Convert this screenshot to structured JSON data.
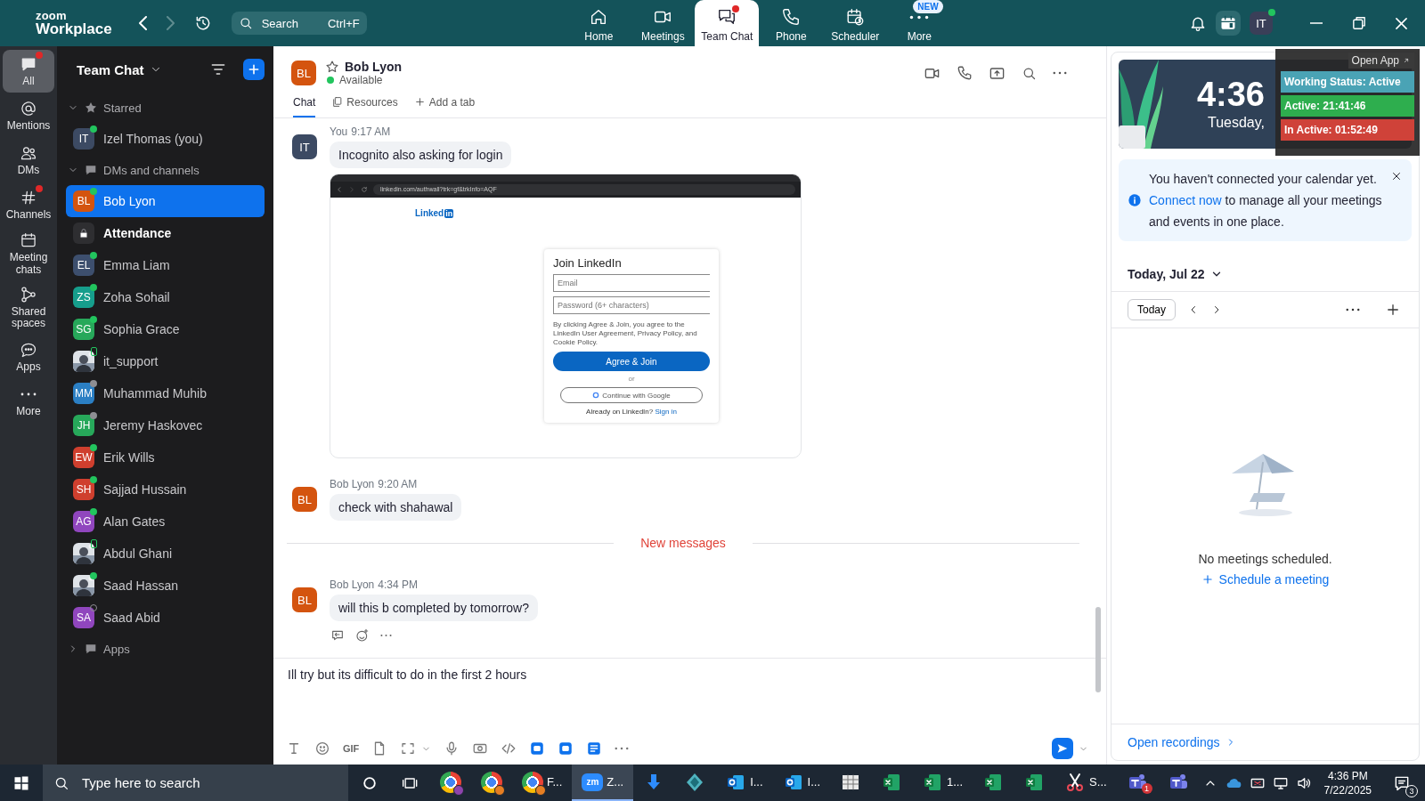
{
  "top_bar": {
    "logo_small": "zoom",
    "logo_large": "Workplace",
    "search": {
      "placeholder": "Search",
      "shortcut": "Ctrl+F"
    },
    "nav": [
      {
        "kind": "home",
        "label": "Home",
        "selected": false,
        "dot": false
      },
      {
        "kind": "video",
        "label": "Meetings",
        "selected": false,
        "dot": false
      },
      {
        "kind": "chat",
        "label": "Team Chat",
        "selected": true,
        "dot": true
      },
      {
        "kind": "phone",
        "label": "Phone",
        "selected": false,
        "dot": false
      },
      {
        "kind": "scheduler",
        "label": "Scheduler",
        "selected": false,
        "dot": false
      },
      {
        "kind": "more",
        "label": "More",
        "selected": false,
        "dot": false,
        "badge": "NEW"
      }
    ],
    "avatar": "IT"
  },
  "rail": [
    {
      "kind": "chat",
      "label": "All",
      "selected": true,
      "dot": true
    },
    {
      "kind": "at",
      "label": "Mentions",
      "selected": false,
      "dot": false
    },
    {
      "kind": "people",
      "label": "DMs",
      "selected": false,
      "dot": false
    },
    {
      "kind": "hash",
      "label": "Channels",
      "selected": false,
      "dot": true
    },
    {
      "kind": "calendar",
      "label": "Meeting chats",
      "selected": false,
      "dot": false
    },
    {
      "kind": "nodes",
      "label": "Shared spaces",
      "selected": false,
      "dot": false
    },
    {
      "kind": "bubble",
      "label": "Apps",
      "selected": false,
      "dot": false
    },
    {
      "kind": "more",
      "label": "More",
      "selected": false,
      "dot": false
    }
  ],
  "sidebar": {
    "title": "Team Chat",
    "sections": [
      {
        "kind": "star",
        "label": "Starred",
        "expanded": true,
        "items": [
          {
            "kind": "initials",
            "initials": "IT",
            "name": "Izel Thomas (you)",
            "color": "#3c4a63",
            "presence": {
              "kind": "online"
            },
            "selected": false,
            "bold": false
          }
        ]
      },
      {
        "kind": "chat",
        "label": "DMs and channels",
        "expanded": true,
        "items": [
          {
            "kind": "initials",
            "initials": "BL",
            "name": "Bob Lyon",
            "color": "#d4540f",
            "presence": {
              "kind": "online"
            },
            "selected": true,
            "bold": false
          },
          {
            "kind": "lock",
            "name": "Attendance",
            "selected": false,
            "bold": true
          },
          {
            "kind": "initials",
            "initials": "EL",
            "name": "Emma Liam",
            "color": "#3d4f6e",
            "presence": {
              "kind": "online"
            },
            "selected": false,
            "bold": false
          },
          {
            "kind": "initials",
            "initials": "ZS",
            "name": "Zoha Sohail",
            "color": "#169e8c",
            "presence": {
              "kind": "online"
            },
            "selected": false,
            "bold": false
          },
          {
            "kind": "initials",
            "initials": "SG",
            "name": "Sophia Grace",
            "color": "#27a85a",
            "presence": {
              "kind": "online"
            },
            "selected": false,
            "bold": false
          },
          {
            "kind": "picture",
            "name": "it_support",
            "presence": {
              "kind": "mobile"
            },
            "selected": false,
            "bold": false
          },
          {
            "kind": "initials",
            "initials": "MM",
            "name": "Muhammad Muhib",
            "color": "#2b7fc4",
            "presence": {
              "kind": "away"
            },
            "selected": false,
            "bold": false
          },
          {
            "kind": "initials",
            "initials": "JH",
            "name": "Jeremy Haskovec",
            "color": "#27a85a",
            "presence": {
              "kind": "away"
            },
            "selected": false,
            "bold": false
          },
          {
            "kind": "initials",
            "initials": "EW",
            "name": "Erik Wills",
            "color": "#cf3f2e",
            "presence": {
              "kind": "online"
            },
            "selected": false,
            "bold": false
          },
          {
            "kind": "initials",
            "initials": "SH",
            "name": "Sajjad Hussain",
            "color": "#cf3f2e",
            "presence": {
              "kind": "online"
            },
            "selected": false,
            "bold": false
          },
          {
            "kind": "initials",
            "initials": "AG",
            "name": "Alan Gates",
            "color": "#9046be",
            "presence": {
              "kind": "online"
            },
            "selected": false,
            "bold": false
          },
          {
            "kind": "picture",
            "name": "Abdul Ghani",
            "presence": {
              "kind": "mobile"
            },
            "selected": false,
            "bold": false
          },
          {
            "kind": "picture",
            "name": "Saad Hassan",
            "presence": {
              "kind": "online"
            },
            "selected": false,
            "bold": false
          },
          {
            "kind": "initials",
            "initials": "SA",
            "name": "Saad Abid",
            "color": "#9046be",
            "presence": {
              "kind": "offline"
            },
            "selected": false,
            "bold": false
          }
        ]
      },
      {
        "kind": "chat",
        "label": "Apps",
        "expanded": false
      }
    ]
  },
  "chat": {
    "header": {
      "initials": "BL",
      "color": "#d4540f",
      "name": "Bob Lyon",
      "status": "Available",
      "starred": false
    },
    "tabs": [
      {
        "kind": "chat",
        "label": "Chat",
        "selected": true
      },
      {
        "kind": "files",
        "label": "Resources",
        "selected": false
      },
      {
        "kind": "add",
        "label": "Add a tab",
        "selected": false
      }
    ],
    "timeline": [
      {
        "kind": "message",
        "sender": "You",
        "time": "9:17 AM",
        "initials": "IT",
        "color": "#3c4a63",
        "text": "Incognito also asking for login",
        "hovered": false,
        "attachment": {
          "url": "linkedin.com/authwall?trk=gf&trkInfo=AQF",
          "logo": "Linked",
          "logo_badge": "in",
          "card_title": "Join LinkedIn",
          "email_placeholder": "Email",
          "password_placeholder": "Password (6+ characters)",
          "terms": "By clicking Agree & Join, you agree to the LinkedIn User Agreement, Privacy Policy, and Cookie Policy.",
          "button": "Agree & Join",
          "separator": "or",
          "google_button": "Continue with Google",
          "signin_prompt": "Already on LinkedIn?",
          "signin_link": "Sign in"
        }
      },
      {
        "kind": "message",
        "sender": "Bob Lyon",
        "time": "9:20 AM",
        "initials": "BL",
        "color": "#d4540f",
        "text": "check with shahawal",
        "hovered": false
      },
      {
        "kind": "divider",
        "label": "New messages"
      },
      {
        "kind": "message",
        "sender": "Bob Lyon",
        "time": "4:34 PM",
        "initials": "BL",
        "color": "#d4540f",
        "text": "will this b completed by tomorrow?",
        "hovered": true
      }
    ],
    "composer": {
      "value": "Ill try but its difficult to do in the first 2 hours",
      "tools": [
        {
          "kind": "format"
        },
        {
          "kind": "emoji"
        },
        {
          "kind": "gif",
          "label": "GIF"
        },
        {
          "kind": "file"
        },
        {
          "kind": "screenshot"
        },
        {
          "kind": "caret"
        },
        {
          "kind": "mic"
        },
        {
          "kind": "video"
        },
        {
          "kind": "code"
        },
        {
          "kind": "app"
        },
        {
          "kind": "app"
        },
        {
          "kind": "doc"
        },
        {
          "kind": "more"
        }
      ]
    }
  },
  "calendar": {
    "widget": {
      "time": "4:36",
      "date": "Tuesday,",
      "open_app": "Open App",
      "statuses": [
        {
          "label": "Working Status: Active",
          "color": "#4aa3b5"
        },
        {
          "label": "Active: 21:41:46",
          "color": "#2eae4e"
        },
        {
          "label": "In Active: 01:52:49",
          "color": "#cf4239"
        }
      ]
    },
    "notice": {
      "text_before": "You haven't connected your calendar yet.",
      "link": "Connect now",
      "text_after": "to manage all your meetings and events in one place."
    },
    "date_label": "Today, Jul 22",
    "today_button": "Today",
    "empty_text": "No meetings scheduled.",
    "schedule_link": "Schedule a meeting",
    "recordings_link": "Open recordings"
  },
  "taskbar": {
    "search_placeholder": "Type here to search",
    "apps": [
      {
        "kind": "chrome",
        "active": false,
        "profile": {
          "color": "#8e44ad"
        }
      },
      {
        "kind": "chrome",
        "active": false,
        "profile": {
          "color": "#e67e22"
        }
      },
      {
        "kind": "chrome",
        "active": false,
        "profile": {
          "color": "#e67e22"
        },
        "label": "F..."
      },
      {
        "kind": "zoom",
        "active": true,
        "logo": "zm",
        "label": "Z..."
      },
      {
        "kind": "download",
        "active": false
      },
      {
        "kind": "kite",
        "active": false
      },
      {
        "kind": "outlook",
        "active": false,
        "label": "I..."
      },
      {
        "kind": "outlook",
        "active": false,
        "label": "I..."
      },
      {
        "kind": "calc",
        "active": false
      },
      {
        "kind": "excel",
        "active": false
      },
      {
        "kind": "excel",
        "active": false,
        "label": "1..."
      },
      {
        "kind": "excel",
        "active": false
      },
      {
        "kind": "excel",
        "active": false
      },
      {
        "kind": "snip",
        "active": false,
        "label": "S..."
      },
      {
        "kind": "teams",
        "active": false,
        "badge": "1"
      },
      {
        "kind": "teams",
        "active": false
      }
    ],
    "time": "4:36 PM",
    "date": "7/22/2025",
    "notifications": "3"
  }
}
